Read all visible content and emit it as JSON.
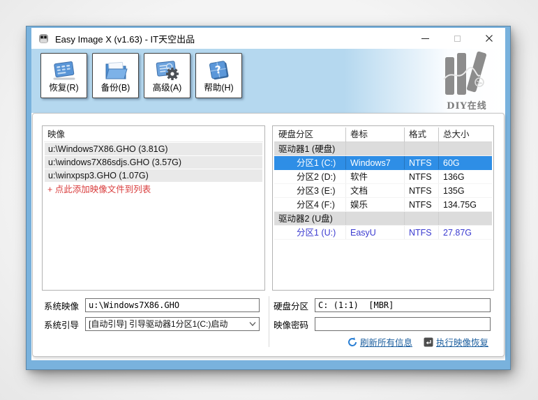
{
  "colors": {
    "window_border": "#79b2dd",
    "toolbar_bg": "#b5d8ef",
    "selected_row_bg": "#2e8ee6",
    "group_row_bg": "#dcdcdc",
    "list_item_bg": "#e9e9e9",
    "add_link_red": "#d93c3c",
    "usb_row_blue": "#3a3ad0",
    "action_link_blue": "#1d5f9f"
  },
  "titlebar": {
    "title": "Easy Image X (v1.63) - IT天空出品"
  },
  "toolbar": {
    "buttons": [
      {
        "label": "恢复(R)",
        "icon": "restore-icon"
      },
      {
        "label": "备份(B)",
        "icon": "backup-icon"
      },
      {
        "label": "高级(A)",
        "icon": "advanced-icon"
      },
      {
        "label": "帮助(H)",
        "icon": "help-icon"
      }
    ],
    "logo_text": "DIY在线"
  },
  "image_panel": {
    "header": "映像",
    "items": [
      "u:\\Windows7X86.GHO (3.81G)",
      "u:\\windows7X86sdjs.GHO (3.57G)",
      "u:\\winxpsp3.GHO (1.07G)"
    ],
    "add_link": "+ 点此添加映像文件到列表"
  },
  "partition_panel": {
    "columns": [
      "硬盘分区",
      "卷标",
      "格式",
      "总大小"
    ],
    "rows": [
      {
        "type": "group",
        "name": "驱动器1 (硬盘)"
      },
      {
        "type": "partition",
        "name": "分区1 (C:)",
        "label": "Windows7",
        "format": "NTFS",
        "size": "60G",
        "selected": true
      },
      {
        "type": "partition",
        "name": "分区2 (D:)",
        "label": "软件",
        "format": "NTFS",
        "size": "136G"
      },
      {
        "type": "partition",
        "name": "分区3 (E:)",
        "label": "文档",
        "format": "NTFS",
        "size": "135G"
      },
      {
        "type": "partition",
        "name": "分区4 (F:)",
        "label": "娱乐",
        "format": "NTFS",
        "size": "134.75G"
      },
      {
        "type": "group",
        "name": "驱动器2 (U盘)"
      },
      {
        "type": "partition",
        "name": "分区1 (U:)",
        "label": "EasyU",
        "format": "NTFS",
        "size": "27.87G",
        "text_blue": true
      }
    ]
  },
  "form": {
    "system_image": {
      "label": "系统映像",
      "value": "u:\\Windows7X86.GHO"
    },
    "system_boot": {
      "label": "系统引导",
      "value": "[自动引导] 引导驱动器1分区1(C:)启动"
    },
    "disk_partition": {
      "label": "硬盘分区",
      "value": "C: (1:1)  [MBR]"
    },
    "image_password": {
      "label": "映像密码",
      "value": ""
    }
  },
  "actions": {
    "refresh": "刷新所有信息",
    "execute": "执行映像恢复"
  }
}
